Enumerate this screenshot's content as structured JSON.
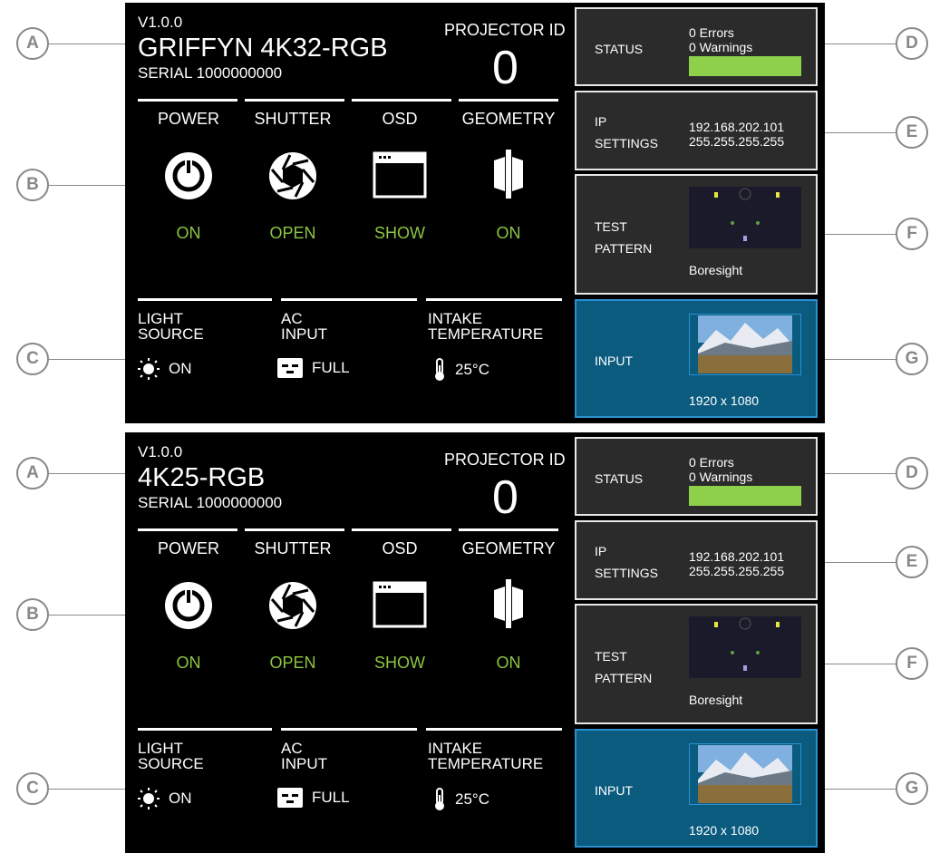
{
  "callouts": {
    "a": "A",
    "b": "B",
    "c": "C",
    "d": "D",
    "e": "E",
    "f": "F",
    "g": "G"
  },
  "panels": [
    {
      "version": "V1.0.0",
      "model": "GRIFFYN 4K32-RGB",
      "serial": "SERIAL 1000000000",
      "projector_id_label": "PROJECTOR ID",
      "projector_id": "0",
      "controls": [
        {
          "label": "POWER",
          "state": "ON",
          "icon": "power-icon"
        },
        {
          "label": "SHUTTER",
          "state": "OPEN",
          "icon": "shutter-icon"
        },
        {
          "label": "OSD",
          "state": "SHOW",
          "icon": "osd-window-icon"
        },
        {
          "label": "GEOMETRY",
          "state": "ON",
          "icon": "geometry-icon"
        }
      ],
      "stats": [
        {
          "label1": "LIGHT",
          "label2": "SOURCE",
          "value": "ON",
          "icon": "sun-icon"
        },
        {
          "label1": "AC",
          "label2": "INPUT",
          "value": "FULL",
          "icon": "plug-icon"
        },
        {
          "label1": "INTAKE",
          "label2": "TEMPERATURE",
          "value": "25°C",
          "icon": "thermometer-icon"
        }
      ],
      "status": {
        "label": "STATUS",
        "errors": "0 Errors",
        "warnings": "0 Warnings",
        "color": "#8dd14a"
      },
      "ip": {
        "label1": "IP",
        "label2": "SETTINGS",
        "address": "192.168.202.101",
        "mask": "255.255.255.255"
      },
      "test_pattern": {
        "label1": "TEST",
        "label2": "PATTERN",
        "name": "Boresight"
      },
      "input": {
        "label": "INPUT",
        "resolution": "1920 x 1080"
      }
    },
    {
      "version": "V1.0.0",
      "model": "4K25-RGB",
      "serial": "SERIAL 1000000000",
      "projector_id_label": "PROJECTOR ID",
      "projector_id": "0",
      "controls": [
        {
          "label": "POWER",
          "state": "ON",
          "icon": "power-icon"
        },
        {
          "label": "SHUTTER",
          "state": "OPEN",
          "icon": "shutter-icon"
        },
        {
          "label": "OSD",
          "state": "SHOW",
          "icon": "osd-window-icon"
        },
        {
          "label": "GEOMETRY",
          "state": "ON",
          "icon": "geometry-icon"
        }
      ],
      "stats": [
        {
          "label1": "LIGHT",
          "label2": "SOURCE",
          "value": "ON",
          "icon": "sun-icon"
        },
        {
          "label1": "AC",
          "label2": "INPUT",
          "value": "FULL",
          "icon": "plug-icon"
        },
        {
          "label1": "INTAKE",
          "label2": "TEMPERATURE",
          "value": "25°C",
          "icon": "thermometer-icon"
        }
      ],
      "status": {
        "label": "STATUS",
        "errors": "0 Errors",
        "warnings": "0 Warnings",
        "color": "#8dd14a"
      },
      "ip": {
        "label1": "IP",
        "label2": "SETTINGS",
        "address": "192.168.202.101",
        "mask": "255.255.255.255"
      },
      "test_pattern": {
        "label1": "TEST",
        "label2": "PATTERN",
        "name": "Boresight"
      },
      "input": {
        "label": "INPUT",
        "resolution": "1920 x 1080"
      }
    }
  ],
  "colors": {
    "state_green": "#8dc63f",
    "card_bg": "#2b2b2b",
    "input_bg": "#0b5b7f",
    "callout_gray": "#888888"
  }
}
